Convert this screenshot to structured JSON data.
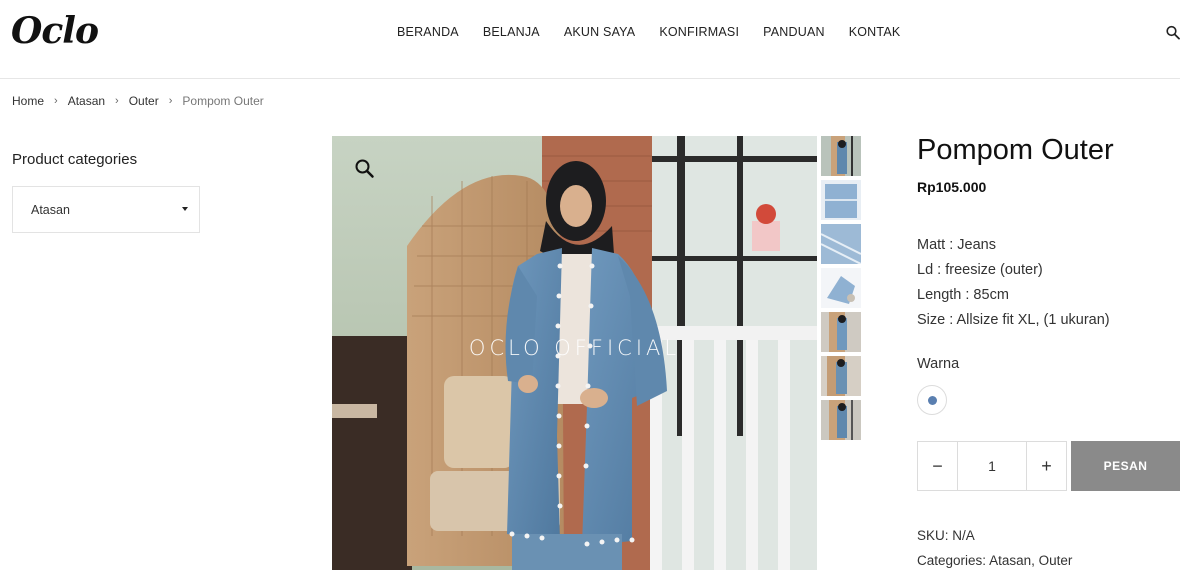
{
  "header": {
    "logo": "Oclo",
    "nav": [
      "BERANDA",
      "BELANJA",
      "AKUN SAYA",
      "KONFIRMASI",
      "PANDUAN",
      "KONTAK"
    ]
  },
  "breadcrumb": {
    "home": "Home",
    "level1": "Atasan",
    "level2": "Outer",
    "current": "Pompom Outer"
  },
  "sidebar": {
    "title": "Product categories",
    "selected_category": "Atasan"
  },
  "gallery": {
    "watermark": "OCLO OFFICIAL",
    "thumbnail_count": 7
  },
  "product": {
    "title": "Pompom Outer",
    "price": "Rp105.000",
    "details": [
      "Matt : Jeans",
      "Ld : freesize (outer)",
      "Length : 85cm",
      "Size : Allsize fit XL, (1 ukuran)"
    ],
    "color_label": "Warna",
    "color_swatch": "#5a7fb0",
    "quantity": "1",
    "minus": "−",
    "plus": "+",
    "order_button": "PESAN",
    "sku_label": "SKU:",
    "sku_value": "N/A",
    "categories_label": "Categories:",
    "categories": [
      "Atasan",
      "Outer"
    ]
  }
}
